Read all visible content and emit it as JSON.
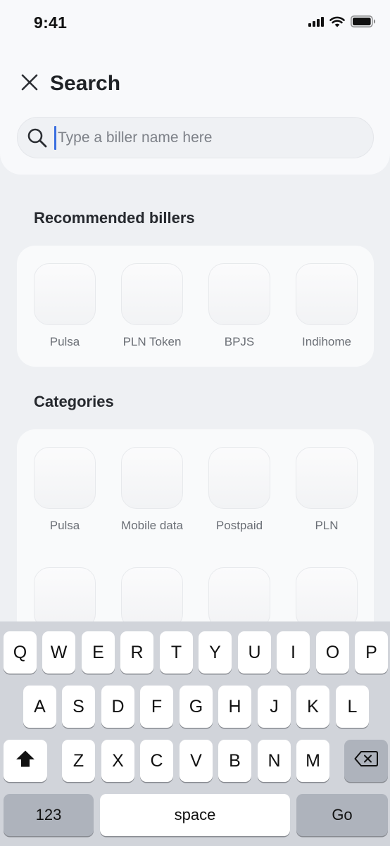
{
  "status_bar": {
    "time": "9:41"
  },
  "header": {
    "title": "Search",
    "search_placeholder": "Type a biller name here"
  },
  "recommended": {
    "title": "Recommended billers",
    "items": [
      {
        "label": "Pulsa"
      },
      {
        "label": "PLN Token"
      },
      {
        "label": "BPJS"
      },
      {
        "label": "Indihome"
      }
    ]
  },
  "categories": {
    "title": "Categories",
    "items": [
      {
        "label": "Pulsa"
      },
      {
        "label": "Mobile data"
      },
      {
        "label": "Postpaid"
      },
      {
        "label": "PLN"
      }
    ]
  },
  "keyboard": {
    "row1": [
      "Q",
      "W",
      "E",
      "R",
      "T",
      "Y",
      "U",
      "I",
      "O",
      "P"
    ],
    "row2": [
      "A",
      "S",
      "D",
      "F",
      "G",
      "H",
      "J",
      "K",
      "L"
    ],
    "row3": [
      "Z",
      "X",
      "C",
      "V",
      "B",
      "N",
      "M"
    ],
    "numbers_label": "123",
    "space_label": "space",
    "go_label": "Go"
  }
}
